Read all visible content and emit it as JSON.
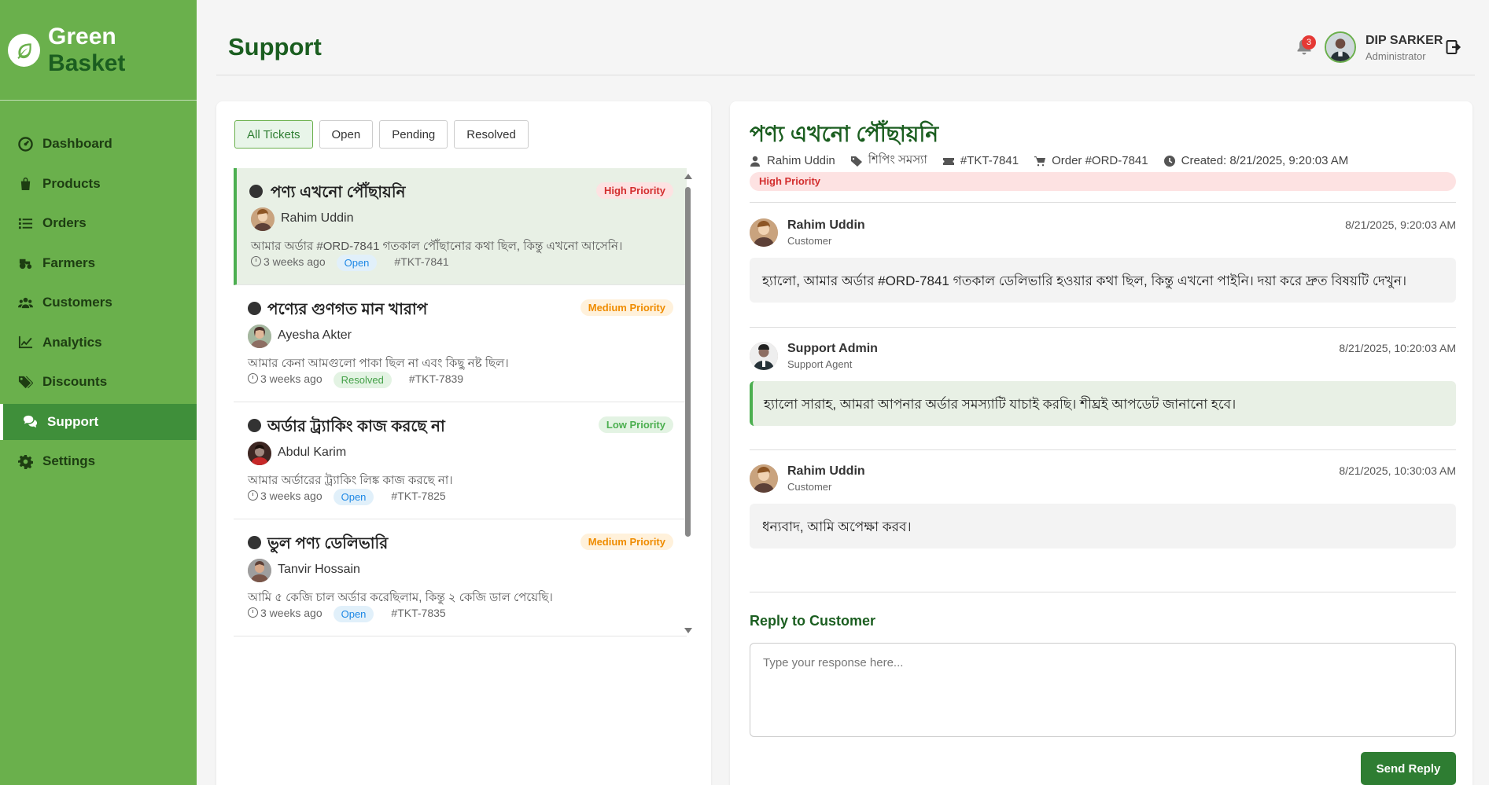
{
  "brand": {
    "name_part1": "Green",
    "name_part2": "Basket"
  },
  "sidebar": {
    "items": [
      {
        "label": "Dashboard",
        "icon": "dashboard-icon"
      },
      {
        "label": "Products",
        "icon": "bag-icon"
      },
      {
        "label": "Orders",
        "icon": "list-icon"
      },
      {
        "label": "Farmers",
        "icon": "tractor-icon"
      },
      {
        "label": "Customers",
        "icon": "users-icon"
      },
      {
        "label": "Analytics",
        "icon": "chart-line-icon"
      },
      {
        "label": "Discounts",
        "icon": "tags-icon"
      },
      {
        "label": "Support",
        "icon": "comments-icon",
        "active": true
      },
      {
        "label": "Settings",
        "icon": "gear-icon"
      }
    ]
  },
  "header": {
    "title": "Support",
    "notification_count": "3",
    "user_name": "DIP SARKER",
    "user_role": "Administrator"
  },
  "filters": {
    "all": "All Tickets",
    "open": "Open",
    "pending": "Pending",
    "resolved": "Resolved",
    "selected": "All Tickets"
  },
  "tickets": [
    {
      "title": "পণ্য এখনো পৌঁছায়নি",
      "priority": "High Priority",
      "customer": "Rahim Uddin",
      "message": "আমার অর্ডার #ORD-7841 গতকাল পৌঁছানোর কথা ছিল, কিন্তু এখনো আসেনি।",
      "time": "3 weeks ago",
      "status": "Open",
      "id": "#TKT-7841"
    },
    {
      "title": "পণ্যের গুণগত মান খারাপ",
      "priority": "Medium Priority",
      "customer": "Ayesha Akter",
      "message": "আমার কেনা আমগুলো পাকা ছিল না এবং কিছু নষ্ট ছিল।",
      "time": "3 weeks ago",
      "status": "Resolved",
      "id": "#TKT-7839"
    },
    {
      "title": "অর্ডার ট্র্যাকিং কাজ করছে না",
      "priority": "Low Priority",
      "customer": "Abdul Karim",
      "message": "আমার অর্ডারের ট্র্যাকিং লিঙ্ক কাজ করছে না।",
      "time": "3 weeks ago",
      "status": "Open",
      "id": "#TKT-7825"
    },
    {
      "title": "ভুল পণ্য ডেলিভারি",
      "priority": "Medium Priority",
      "customer": "Tanvir Hossain",
      "message": "আমি ৫ কেজি চাল অর্ডার করেছিলাম, কিন্তু ২ কেজি ডাল পেয়েছি।",
      "time": "3 weeks ago",
      "status": "Open",
      "id": "#TKT-7835"
    }
  ],
  "detail": {
    "title": "পণ্য এখনো পৌঁছায়নি",
    "customer": "Rahim Uddin",
    "category": "শিপিং সমস্যা",
    "ticket_id": "#TKT-7841",
    "order": "Order #ORD-7841",
    "created": "Created: 8/21/2025, 9:20:03 AM",
    "priority": "High Priority",
    "messages": [
      {
        "name": "Rahim Uddin",
        "role": "Customer",
        "time": "8/21/2025, 9:20:03 AM",
        "text": "হ্যালো, আমার অর্ডার #ORD-7841 গতকাল ডেলিভারি হওয়ার কথা ছিল, কিন্তু এখনো পাইনি। দয়া করে দ্রুত বিষয়টি দেখুন।"
      },
      {
        "name": "Support Admin",
        "role": "Support Agent",
        "time": "8/21/2025, 10:20:03 AM",
        "text": "হ্যালো সারাহ, আমরা আপনার অর্ডার সমস্যাটি যাচাই করছি। শীঘ্রই আপডেট জানানো হবে।"
      },
      {
        "name": "Rahim Uddin",
        "role": "Customer",
        "time": "8/21/2025, 10:30:03 AM",
        "text": "ধন্যবাদ, আমি অপেক্ষা করব।"
      }
    ],
    "reply_title": "Reply to Customer",
    "reply_placeholder": "Type your response here...",
    "send_label": "Send Reply"
  },
  "colors": {
    "sidebar": "#6ab04c",
    "active_nav": "#3f8f3a",
    "brand_dark": "#1b5e20",
    "send_button": "#2e7d32"
  }
}
